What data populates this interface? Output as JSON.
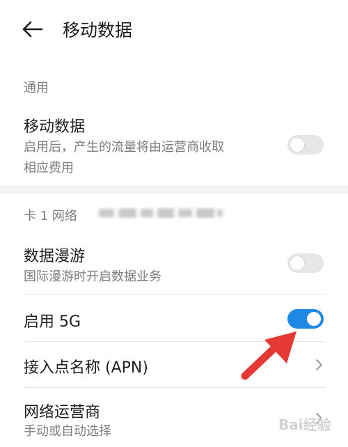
{
  "header": {
    "title": "移动数据",
    "back_icon": "arrow-left-icon"
  },
  "general": {
    "section_title": "通用",
    "mobile_data": {
      "title": "移动数据",
      "description": [
        "启用后，产生的流量将由运营商收取",
        "相应费用"
      ],
      "enabled": false
    }
  },
  "sim1": {
    "section_title": "卡 1 网络",
    "roaming": {
      "title": "数据漫游",
      "description": "国际漫游时开启数据业务",
      "enabled": false
    },
    "enable_5g": {
      "title": "启用 5G",
      "enabled": true
    },
    "apn": {
      "title": "接入点名称 (APN)",
      "icon": "chevron-right-icon"
    },
    "carrier": {
      "title": "网络运营商",
      "description": "手动或自动选择",
      "icon": "chevron-right-icon"
    }
  },
  "overlays": {
    "arrow_color": "#e53935",
    "toggle_on_color": "#1e88e5",
    "watermark": "Bai经验"
  }
}
